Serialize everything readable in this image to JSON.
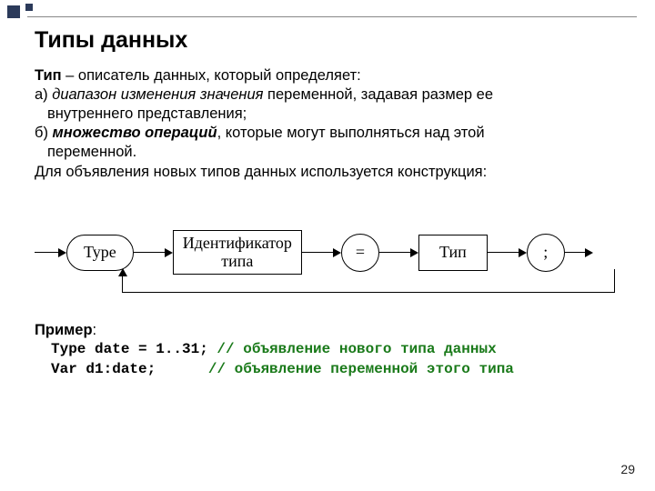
{
  "header_square1": "",
  "header_square2": "",
  "title": "Типы данных",
  "para": {
    "line1_a": "Тип",
    "line1_b": " – описатель данных, который определяет:",
    "a_label": "а) ",
    "a_ital": "диапазон изменения значения",
    "a_rest": " переменной, задавая размер ее",
    "a_cont": "внутреннего представления;",
    "b_label": "б) ",
    "b_ital": "множество операций",
    "b_rest": ", которые могут выполняться над этой",
    "b_cont": "переменной.",
    "line_decl": "Для объявления новых типов данных используется конструкция:"
  },
  "diagram": {
    "n1": "Type",
    "n2": "Идентификатор\nтипа",
    "n3": "=",
    "n4": "Тип",
    "n5": ";"
  },
  "example": {
    "label": "Пример",
    "colon": ":",
    "code1": "Type date = 1..31;",
    "comment1": " // объявление нового типа данных",
    "code2": "Var d1:date;     ",
    "comment2": " // объявление переменной этого типа"
  },
  "pagenum": "29"
}
